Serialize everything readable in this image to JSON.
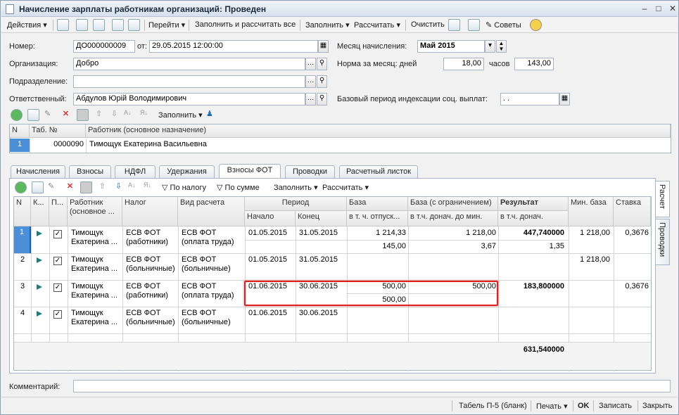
{
  "window": {
    "title": "Начисление зарплаты работникам организаций: Проведен"
  },
  "toolbar": {
    "actions": "Действия",
    "goto": "Перейти",
    "fill_calc_all": "Заполнить и рассчитать все",
    "fill": "Заполнить",
    "calc": "Рассчитать",
    "clear": "Очистить",
    "tips": "Советы"
  },
  "header": {
    "number_label": "Номер:",
    "number": "ДО000000009",
    "from_label": "от:",
    "date": "29.05.2015 12:00:00",
    "month_label": "Месяц начисления:",
    "month": "Май 2015",
    "org_label": "Организация:",
    "org": "Добро",
    "norm_label": "Норма за месяц: дней",
    "norm_days": "18,00",
    "hours_label": "часов",
    "norm_hours": "143,00",
    "dept_label": "Подразделение:",
    "dept": "",
    "resp_label": "Ответственный:",
    "resp": "Абдулов Юрій Володимирович",
    "base_period_label": "Базовый период индексации соц. выплат:",
    "base_period": ". ."
  },
  "emp_toolbar": {
    "fill": "Заполнить"
  },
  "emp_grid": {
    "cols": [
      "N",
      "Таб. №",
      "Работник (основное назначение)"
    ],
    "rows": [
      {
        "n": "1",
        "tab": "0000090",
        "name": "Тимощук Екатерина Васильевна"
      }
    ]
  },
  "tabs": [
    "Начисления",
    "Взносы",
    "НДФЛ",
    "Удержания",
    "Взносы ФОТ",
    "Проводки",
    "Расчетный листок"
  ],
  "side_tabs": [
    "Расчет",
    "Проводки"
  ],
  "fot_toolbar": {
    "by_tax": "По налогу",
    "by_sum": "По сумме",
    "fill": "Заполнить",
    "calc": "Рассчитать"
  },
  "fot_grid": {
    "h_n": "N",
    "h_k": "К...",
    "h_p": "П...",
    "h_worker": "Работник (основное ...",
    "h_tax": "Налог",
    "h_calc": "Вид расчета",
    "h_period": "Период",
    "h_start": "Начало",
    "h_end": "Конец",
    "h_base": "База",
    "h_base_sub": "в т. ч. отпуск...",
    "h_base_lim": "База (с ограничением)",
    "h_base_lim_sub": "в т.ч. донач. до мин.",
    "h_result": "Результат",
    "h_result_sub": "в т.ч. донач.",
    "h_minbase": "Мин. база",
    "h_rate": "Ставка",
    "rows": [
      {
        "n": "1",
        "w1": "Тимощук",
        "w2": "Екатерина ...",
        "t1": "ЕСВ ФОТ",
        "t2": "(работники)",
        "c1": "ЕСВ ФОТ",
        "c2": "(оплата труда)",
        "start": "01.05.2015",
        "end": "31.05.2015",
        "base": "1 214,33",
        "base2": "145,00",
        "lim": "1 218,00",
        "lim2": "3,67",
        "res": "447,740000",
        "res2": "1,35",
        "minb": "1 218,00",
        "rate": "0,3676"
      },
      {
        "n": "2",
        "w1": "Тимощук",
        "w2": "Екатерина ...",
        "t1": "ЕСВ ФОТ",
        "t2": "(больничные)",
        "c1": "ЕСВ ФОТ",
        "c2": "(больничные)",
        "start": "01.05.2015",
        "end": "31.05.2015",
        "base": "",
        "base2": "",
        "lim": "",
        "lim2": "",
        "res": "",
        "res2": "",
        "minb": "1 218,00",
        "rate": ""
      },
      {
        "n": "3",
        "w1": "Тимощук",
        "w2": "Екатерина ...",
        "t1": "ЕСВ ФОТ",
        "t2": "(работники)",
        "c1": "ЕСВ ФОТ",
        "c2": "(оплата труда)",
        "start": "01.06.2015",
        "end": "30.06.2015",
        "base": "500,00",
        "base2": "500,00",
        "lim": "500,00",
        "lim2": "",
        "res": "183,800000",
        "res2": "",
        "minb": "",
        "rate": "0,3676"
      },
      {
        "n": "4",
        "w1": "Тимощук",
        "w2": "Екатерина ...",
        "t1": "ЕСВ ФОТ",
        "t2": "(больничные)",
        "c1": "ЕСВ ФОТ",
        "c2": "(больничные)",
        "start": "01.06.2015",
        "end": "30.06.2015",
        "base": "",
        "base2": "",
        "lim": "",
        "lim2": "",
        "res": "",
        "res2": "",
        "minb": "",
        "rate": ""
      }
    ],
    "total": "631,540000"
  },
  "comment": {
    "label": "Комментарий:",
    "value": ""
  },
  "status": {
    "tabel": "Табель П-5 (бланк)",
    "print": "Печать",
    "ok": "OK",
    "save": "Записать",
    "close": "Закрыть"
  }
}
